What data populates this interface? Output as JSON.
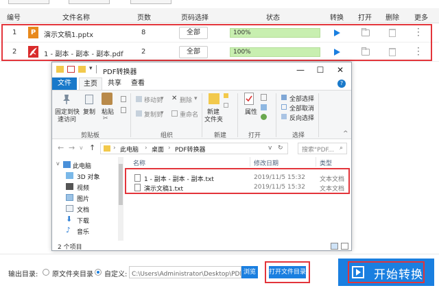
{
  "columns": {
    "num": "编号",
    "filename": "文件名称",
    "pages": "页数",
    "page_select": "页码选择",
    "status": "状态",
    "convert": "转换",
    "open": "打开",
    "delete": "删除",
    "more": "更多"
  },
  "files": [
    {
      "num": "1",
      "icon_text": "P",
      "name": "演示文稿1.pptx",
      "pages": "8",
      "select": "全部",
      "progress_label": "100%",
      "progress": 1.0
    },
    {
      "num": "2",
      "icon_text": "",
      "name": "1 - 副本 - 副本 - 副本.pdf",
      "pages": "2",
      "select": "全部",
      "progress_label": "100%",
      "progress": 1.0
    }
  ],
  "explorer": {
    "title": "PDF转换器",
    "tabs": {
      "file": "文件",
      "home": "主页",
      "share": "共享",
      "view": "查看"
    },
    "ribbon": {
      "pin": "固定到快",
      "pin2": "速访问",
      "copy": "复制",
      "paste": "粘贴",
      "move_to": "移动到",
      "copy_to": "复制到",
      "delete": "删除",
      "rename": "重命名",
      "new_folder": "新建",
      "new_folder2": "文件夹",
      "properties": "属性",
      "select_all": "全部选择",
      "select_none": "全部取消",
      "invert": "反向选择",
      "grp_clipboard": "剪贴板",
      "grp_organize": "组织",
      "grp_new": "新建",
      "grp_open": "打开",
      "grp_select": "选择"
    },
    "address": {
      "pc": "此电脑",
      "desktop": "桌面",
      "folder": "PDF转换器"
    },
    "search_placeholder": "搜索\"PDF...",
    "nav_items": [
      "此电脑",
      "3D 对象",
      "视频",
      "图片",
      "文档",
      "下载",
      "音乐"
    ],
    "headers": {
      "name": "名称",
      "date": "修改日期",
      "type": "类型"
    },
    "rows": [
      {
        "name": "1 - 副本 - 副本 - 副本.txt",
        "date": "2019/11/5 15:32",
        "type": "文本文档"
      },
      {
        "name": "演示文稿1.txt",
        "date": "2019/11/5 15:32",
        "type": "文本文档"
      }
    ],
    "status": "2 个项目"
  },
  "bottom": {
    "output_label": "输出目录:",
    "option_source": "原文件夹目录",
    "option_custom": "自定义:",
    "path": "C:\\Users\\Administrator\\Desktop\\PDF转换",
    "browse": "浏览",
    "open_dir": "打开文件目录",
    "start": "开始转换"
  }
}
